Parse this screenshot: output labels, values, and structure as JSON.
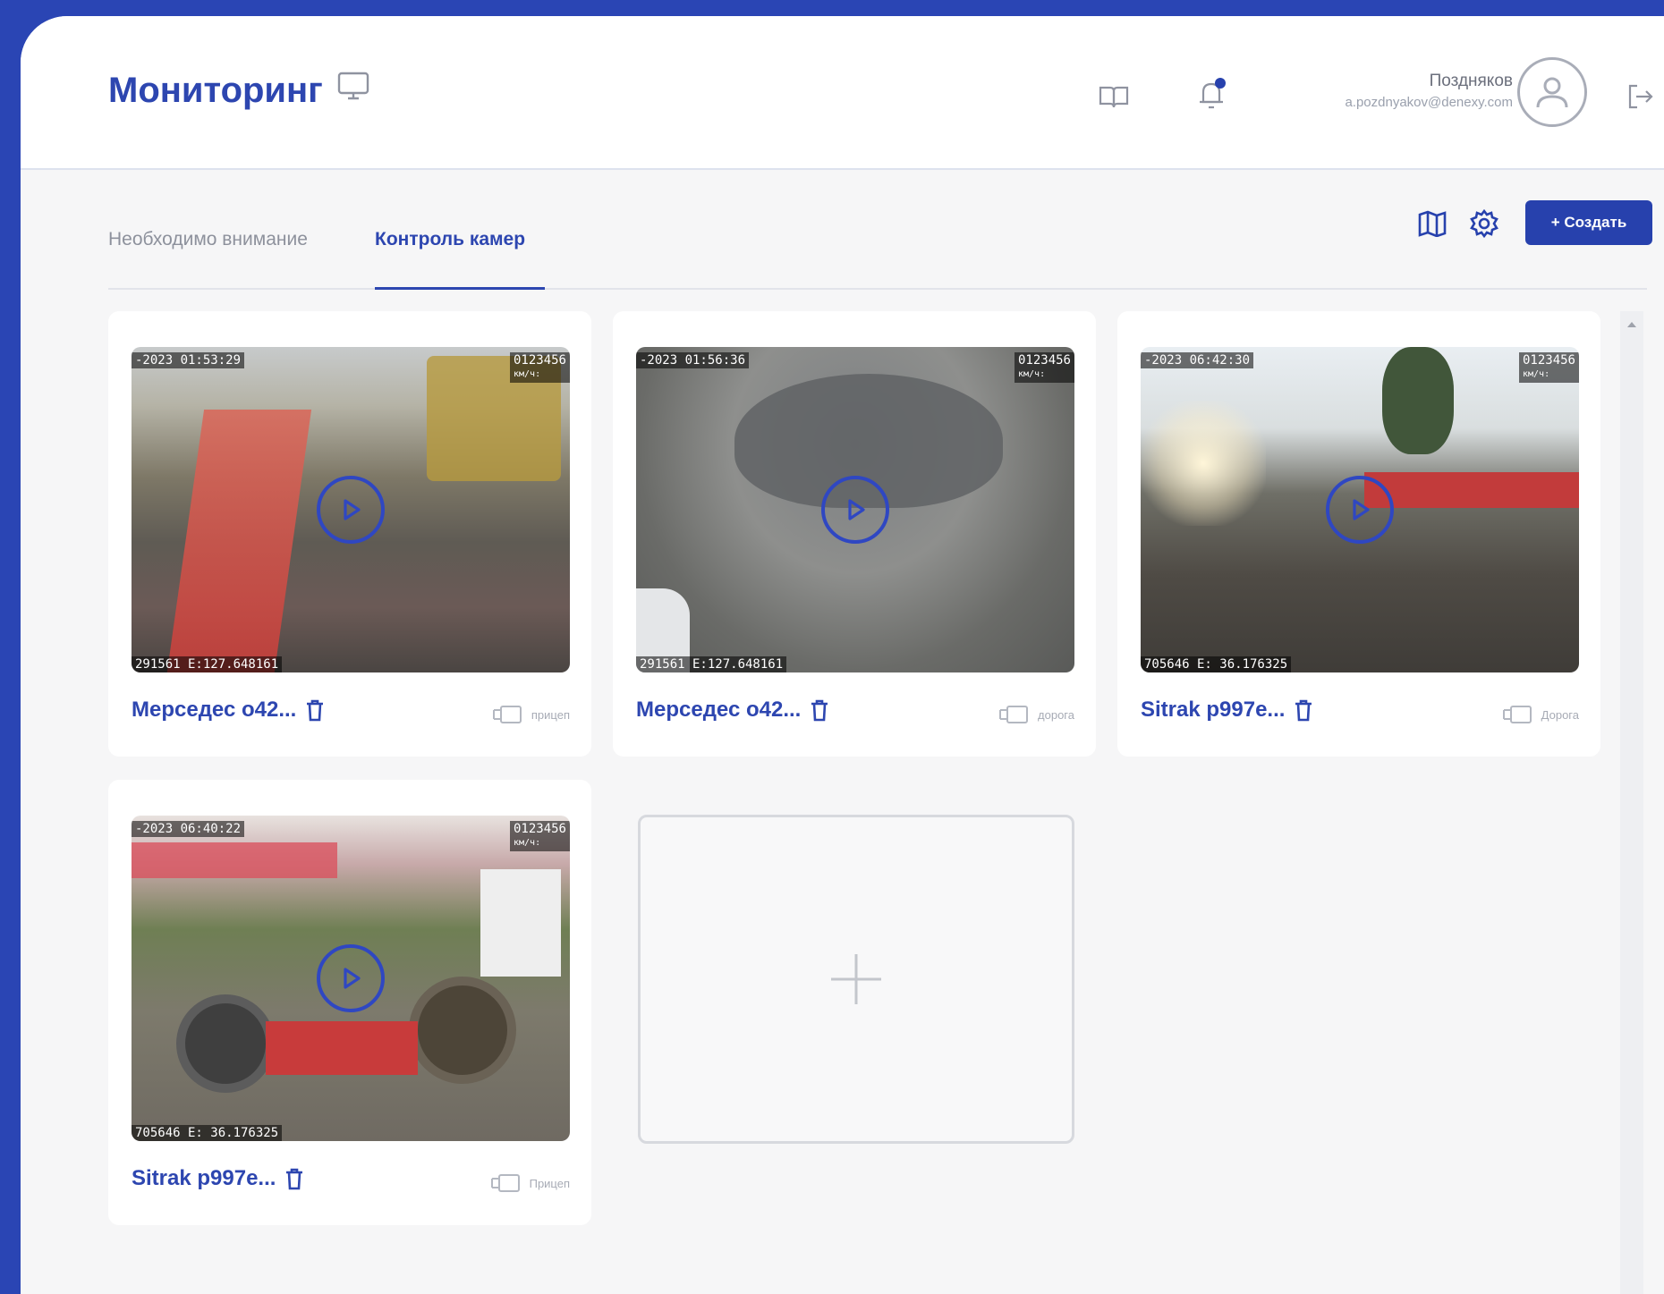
{
  "header": {
    "title": "Мониторинг",
    "user": {
      "name": "Поздняков",
      "email": "a.pozdnyakov@denexy.com"
    }
  },
  "tabs": [
    {
      "label": "Необходимо внимание",
      "active": false
    },
    {
      "label": "Контроль камер",
      "active": true
    }
  ],
  "toolbar": {
    "create_label": "+ Создать"
  },
  "cameras": [
    {
      "title": "Мерседес о42...",
      "tag": "прицеп",
      "ts": "-2023 01:53:29",
      "code": "0123456",
      "speed": "км/ч:",
      "coords": "291561 E:127.648161"
    },
    {
      "title": "Мерседес о42...",
      "tag": "дорога",
      "ts": "-2023 01:56:36",
      "code": "0123456",
      "speed": "км/ч:",
      "coords": "291561 E:127.648161"
    },
    {
      "title": "Sitrak р997е...",
      "tag": "Дорога",
      "ts": "-2023 06:42:30",
      "code": "0123456",
      "speed": "км/ч:",
      "coords": "705646 E: 36.176325"
    },
    {
      "title": "Sitrak р997е...",
      "tag": "Прицеп",
      "ts": "-2023 06:40:22",
      "code": "0123456",
      "speed": "км/ч:",
      "coords": "705646 E: 36.176325"
    }
  ],
  "colors": {
    "brand": "#2d46b0",
    "frame": "#2a45b4",
    "button": "#2741ad"
  }
}
